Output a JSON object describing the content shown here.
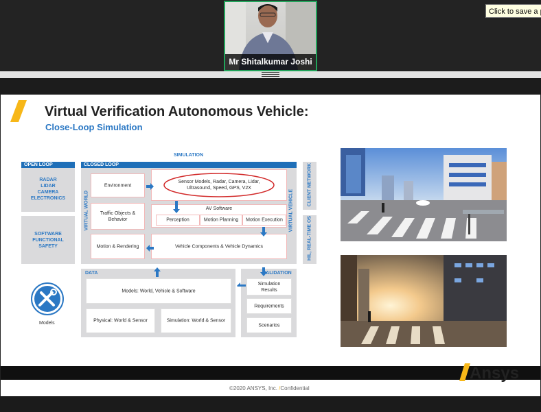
{
  "tooltip": {
    "text": "Click to save a p"
  },
  "meeting": {
    "participant_name": "Mr Shitalkumar  Joshi",
    "active_speaker_color": "#22a35a"
  },
  "slide": {
    "title": "Virtual Verification Autonomous Vehicle:",
    "subtitle": "Close-Loop Simulation",
    "accent_color": "#f7b718",
    "brand_blue": "#1f6fb8",
    "diagram": {
      "simulation_label": "SIMULATION",
      "open_loop": {
        "header": "OPEN LOOP",
        "sensors": [
          "RADAR",
          "LIDAR",
          "CAMERA",
          "ELECTRONICS"
        ],
        "software": [
          "SOFTWARE",
          "FUNCTIONAL",
          "SAFETY"
        ]
      },
      "closed_loop": {
        "header": "CLOSED LOOP",
        "virtual_world": "VIRTUAL WORLD",
        "virtual_vehicle": "VIRTUAL VEHICLE",
        "environment": "Environment",
        "sensor_models": [
          "Sensor Models, Radar, Camera, Lidar,",
          "Ultrasound, Speed, GPS, V2X"
        ],
        "traffic": [
          "Traffic Objects &",
          "Behavior"
        ],
        "av_software": "AV Software",
        "perception": "Perception",
        "motion_planning": "Motion Planning",
        "motion_execution": "Motion Execution",
        "motion_rendering": "Motion & Rendering",
        "vehicle_components": "Vehicle Components & Vehicle Dynamics"
      },
      "client_network": "CLIENT NETWORK",
      "hil": "HIL, REAL-TIME OS",
      "models_label": "Models",
      "data": {
        "header": "DATA",
        "models": "Models: World, Vehicle & Software",
        "physical": "Physical: World & Sensor",
        "simulation": "Simulation: World & Sensor"
      },
      "validation": {
        "header": "VALIDATION",
        "results": [
          "Simulation",
          "Results"
        ],
        "requirements": "Requirements",
        "scenarios": "Scenarios"
      }
    },
    "logo": "Ansys",
    "footer": {
      "copyright": "©2020 ANSYS, Inc.",
      "separator": "/",
      "confidential": "Confidential"
    }
  }
}
